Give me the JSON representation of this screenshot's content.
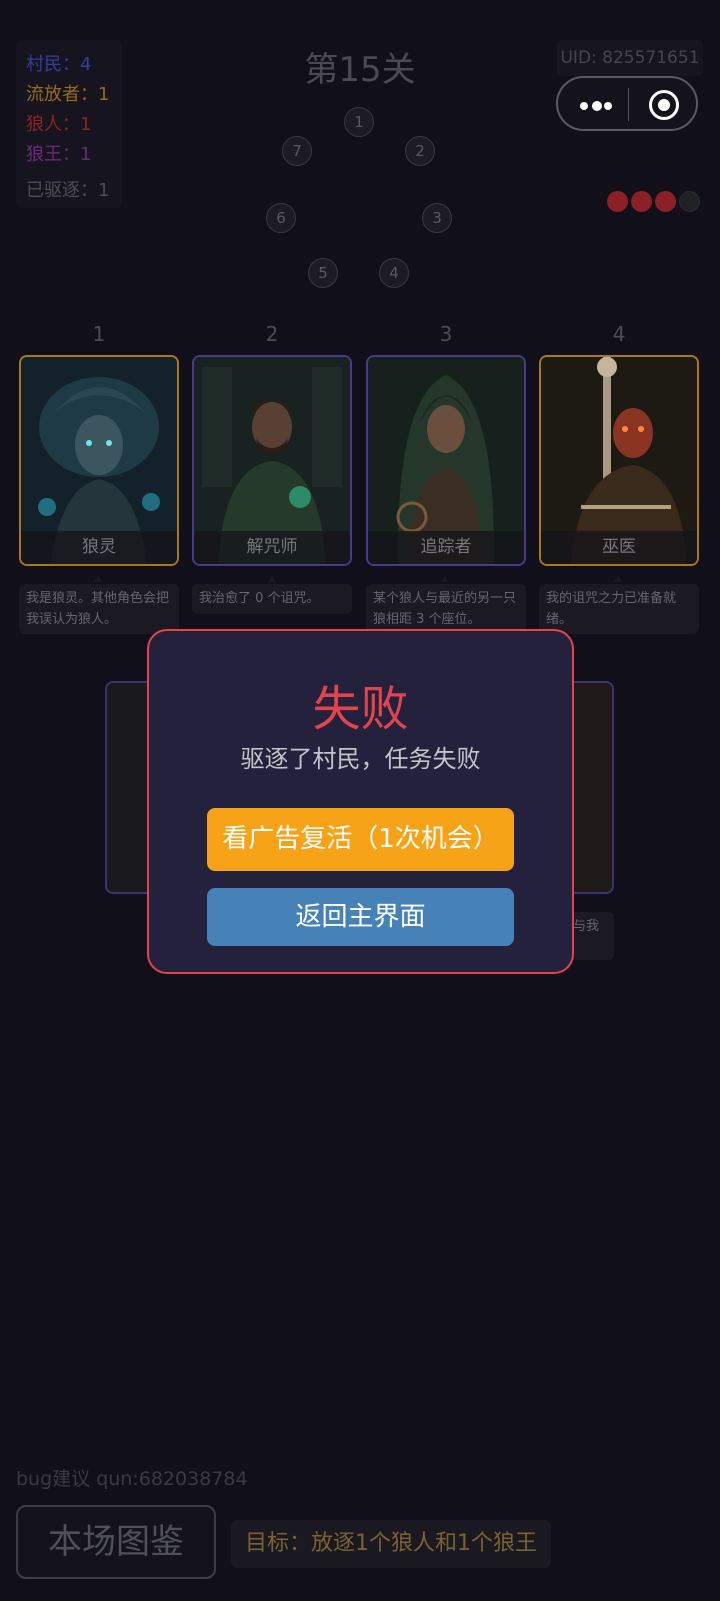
{
  "stats": [
    {
      "label": "村民：4",
      "color": "#3b3a9e"
    },
    {
      "label": "流放者：1",
      "color": "#9a6a1c"
    },
    {
      "label": "狼人：1",
      "color": "#8a2424"
    },
    {
      "label": "狼王：1",
      "color": "#6a2a7a"
    },
    {
      "label": "已驱逐：1",
      "color": "#4e4d55"
    }
  ],
  "level_title": "第15关",
  "uid": "UID: 825571651",
  "capsule": {
    "menu_icon": "more-dots-icon",
    "close_icon": "target-circle-icon"
  },
  "lives": {
    "colors": [
      "#8c2024",
      "#8c2024",
      "#8c2024",
      "#202027"
    ],
    "filled": 3,
    "total": 4
  },
  "seats": [
    "1",
    "2",
    "3",
    "4",
    "5",
    "6",
    "7"
  ],
  "cards": [
    {
      "number": "1",
      "name": "狼灵",
      "border": "#a8791a",
      "desc": "我是狼灵。其他角色会把我误认为狼人。"
    },
    {
      "number": "2",
      "name": "解咒师",
      "border": "#4a3a8a",
      "desc": "我治愈了 0 个诅咒。"
    },
    {
      "number": "3",
      "name": "追踪者",
      "border": "#4a3a8a",
      "desc": "某个狼人与最近的另一只狼相距 3 个座位。"
    },
    {
      "number": "4",
      "name": "巫医",
      "border": "#a8791a",
      "desc": "我的诅咒之力已准备就绪。"
    }
  ],
  "bg_desc_fragment": "与我",
  "modal": {
    "title": "失败",
    "message": "驱逐了村民，任务失败",
    "revive_label": "看广告复活（1次机会）",
    "home_label": "返回主界面"
  },
  "bug_text": "bug建议 qun:682038784",
  "guide_button": "本场图鉴",
  "goal_text": "目标：放逐1个狼人和1个狼王"
}
